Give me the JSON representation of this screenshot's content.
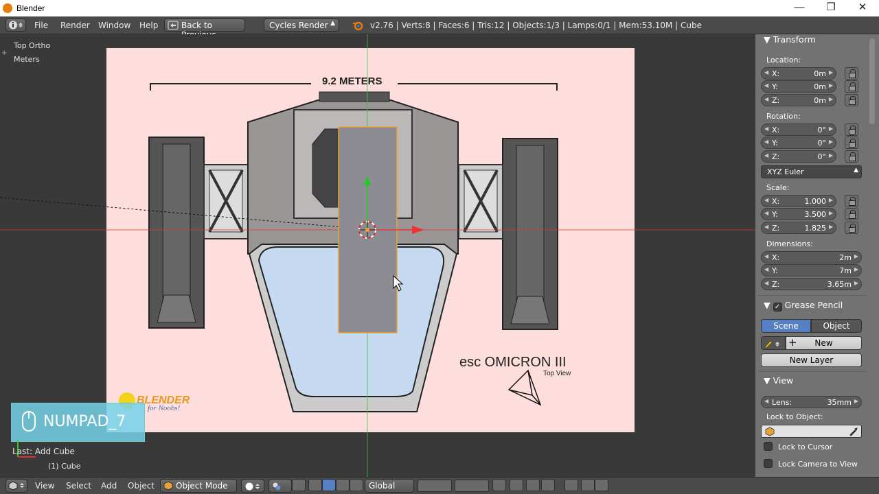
{
  "window": {
    "title": "Blender",
    "minimize_glyph": "—",
    "maximize_glyph": "❐",
    "close_glyph": "✕"
  },
  "menu": {
    "file": "File",
    "render": "Render",
    "window": "Window",
    "help": "Help",
    "back_to_previous": "Back to Previous",
    "engine": "Cycles Render",
    "stats": "v2.76 | Verts:8 | Faces:6 | Tris:12 | Objects:1/3 | Lamps:0/1 | Mem:53.10M | Cube"
  },
  "viewport": {
    "view_name": "Top Ortho",
    "units": "Meters",
    "blueprint_dimension": "9.2 METERS",
    "blueprint_title": "esc OMICRON III",
    "blueprint_subtitle": "Top View",
    "watermark": "BLENDER",
    "watermark_sub": "for Noobs!",
    "key_overlay": "NUMPAD_7",
    "last_operator": "Last: Add Cube",
    "active_object": "(1) Cube"
  },
  "panel": {
    "transform_title": "Transform",
    "location_label": "Location:",
    "location": [
      {
        "axis": "X:",
        "value": "0m"
      },
      {
        "axis": "Y:",
        "value": "0m"
      },
      {
        "axis": "Z:",
        "value": "0m"
      }
    ],
    "rotation_label": "Rotation:",
    "rotation": [
      {
        "axis": "X:",
        "value": "0°"
      },
      {
        "axis": "Y:",
        "value": "0°"
      },
      {
        "axis": "Z:",
        "value": "0°"
      }
    ],
    "rotation_mode": "XYZ Euler",
    "scale_label": "Scale:",
    "scale": [
      {
        "axis": "X:",
        "value": "1.000"
      },
      {
        "axis": "Y:",
        "value": "3.500"
      },
      {
        "axis": "Z:",
        "value": "1.825"
      }
    ],
    "dimensions_label": "Dimensions:",
    "dimensions": [
      {
        "axis": "X:",
        "value": "2m"
      },
      {
        "axis": "Y:",
        "value": "7m"
      },
      {
        "axis": "Z:",
        "value": "3.65m"
      }
    ],
    "grease_pencil_title": "Grease Pencil",
    "gp_scene": "Scene",
    "gp_object": "Object",
    "gp_new": "New",
    "gp_new_layer": "New Layer",
    "view_title": "View",
    "lens_label": "Lens:",
    "lens_value": "35mm",
    "lock_to_object_label": "Lock to Object:",
    "lock_to_cursor": "Lock to Cursor",
    "lock_camera_to_view": "Lock Camera to View"
  },
  "footer": {
    "view": "View",
    "select": "Select",
    "add": "Add",
    "object": "Object",
    "mode": "Object Mode",
    "orientation": "Global"
  },
  "colors": {
    "accent_blue": "#5680c2",
    "selection_orange": "#f0a030",
    "x_axis": "#e33",
    "y_axis": "#2c2",
    "blueprint_bg": "#fddedd"
  }
}
